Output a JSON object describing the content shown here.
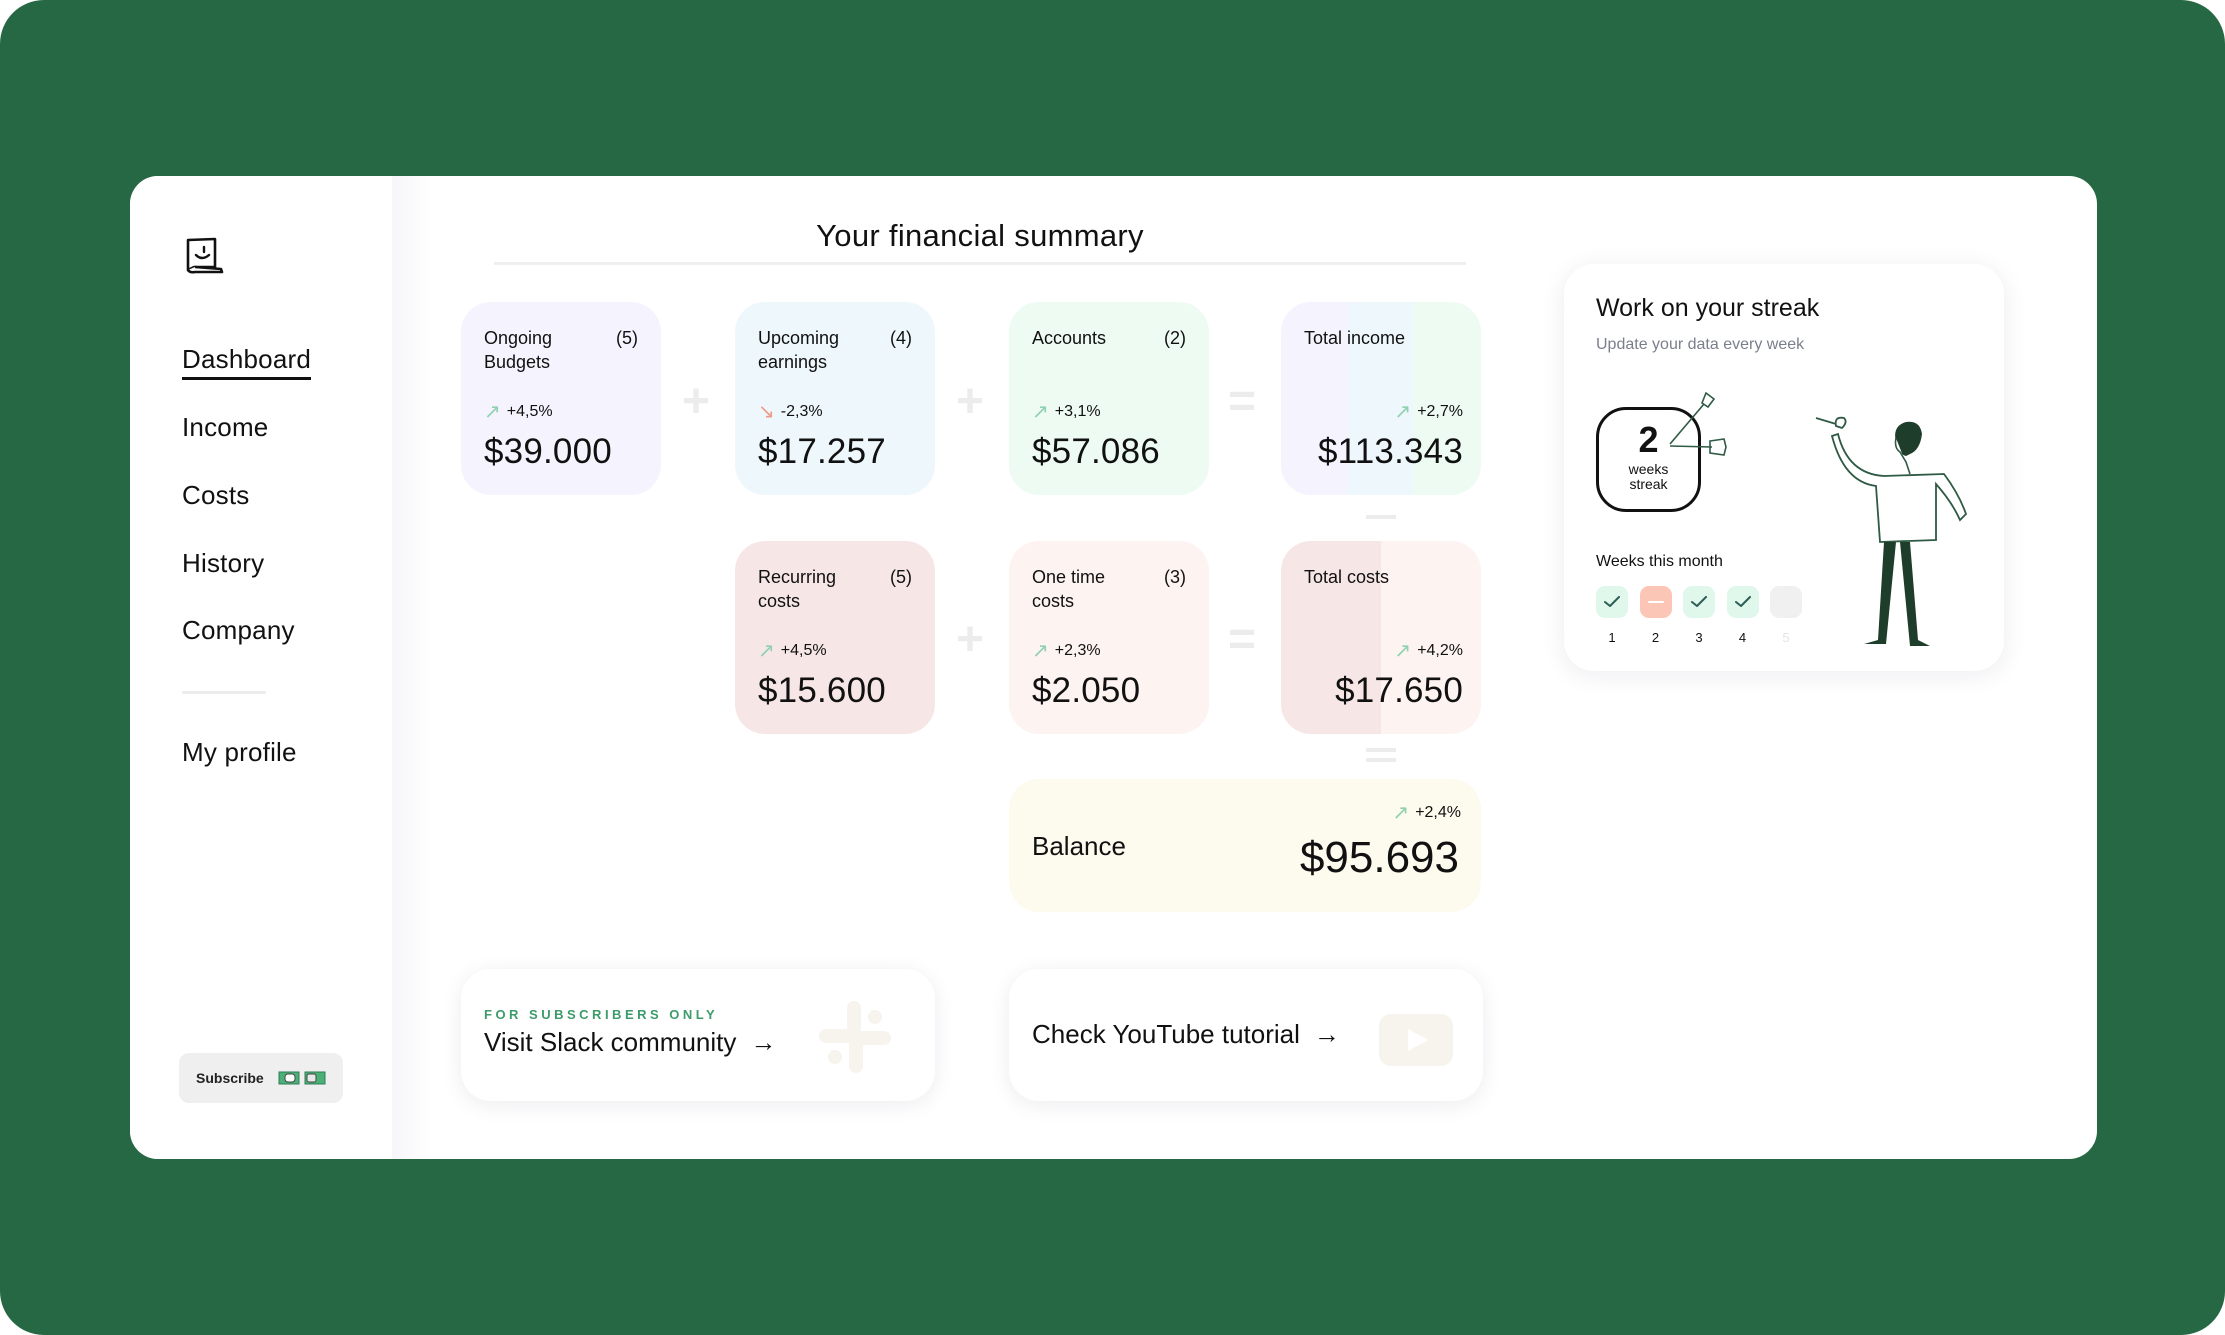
{
  "sidebar": {
    "logo": "smiley-scroll-logo",
    "nav": [
      {
        "label": "Dashboard",
        "active": true
      },
      {
        "label": "Income",
        "active": false
      },
      {
        "label": "Costs",
        "active": false
      },
      {
        "label": "History",
        "active": false
      },
      {
        "label": "Company",
        "active": false
      }
    ],
    "profile_label": "My profile",
    "subscribe_label": "Subscribe"
  },
  "summary": {
    "title": "Your financial summary",
    "cards": {
      "ongoing_budgets": {
        "label": "Ongoing Budgets",
        "count": "(5)",
        "change": "+4,5%",
        "trend": "up",
        "value": "$39.000",
        "color": "#f5f3fd"
      },
      "upcoming_earnings": {
        "label": "Upcoming earnings",
        "count": "(4)",
        "change": "-2,3%",
        "trend": "down",
        "value": "$17.257",
        "color": "#eef7fc"
      },
      "accounts": {
        "label": "Accounts",
        "count": "(2)",
        "change": "+3,1%",
        "trend": "up",
        "value": "$57.086",
        "color": "#edfbf3"
      },
      "total_income": {
        "label": "Total income",
        "change": "+2,7%",
        "trend": "up",
        "value": "$113.343"
      },
      "recurring_costs": {
        "label": "Recurring costs",
        "count": "(5)",
        "change": "+4,5%",
        "trend": "up",
        "value": "$15.600",
        "color": "#f6e6e6"
      },
      "one_time_costs": {
        "label": "One time costs",
        "count": "(3)",
        "change": "+2,3%",
        "trend": "up",
        "value": "$2.050",
        "color": "#fdf3f1"
      },
      "total_costs": {
        "label": "Total costs",
        "change": "+4,2%",
        "trend": "up",
        "value": "$17.650"
      }
    },
    "balance": {
      "label": "Balance",
      "change": "+2,4%",
      "trend": "up",
      "value": "$95.693",
      "color": "#fdfaee"
    },
    "operators": {
      "plus": "+",
      "equals": "="
    }
  },
  "links": {
    "slack": {
      "eyebrow": "FOR SUBSCRIBERS ONLY",
      "label": "Visit Slack community",
      "arrow": "→"
    },
    "youtube": {
      "label": "Check YouTube tutorial",
      "arrow": "→"
    }
  },
  "streak": {
    "title": "Work on your streak",
    "subtitle": "Update your data every week",
    "count": "2",
    "unit_line1": "weeks",
    "unit_line2": "streak",
    "weeks_label": "Weeks this month",
    "weeks": [
      {
        "num": "1",
        "status": "done"
      },
      {
        "num": "2",
        "status": "missed"
      },
      {
        "num": "3",
        "status": "done"
      },
      {
        "num": "4",
        "status": "done"
      },
      {
        "num": "5",
        "status": "future"
      }
    ]
  },
  "colors": {
    "frame": "#256843",
    "accent_green": "#3d9a6b",
    "trend_up": "#8fd1b0",
    "trend_down": "#eb9b87"
  }
}
